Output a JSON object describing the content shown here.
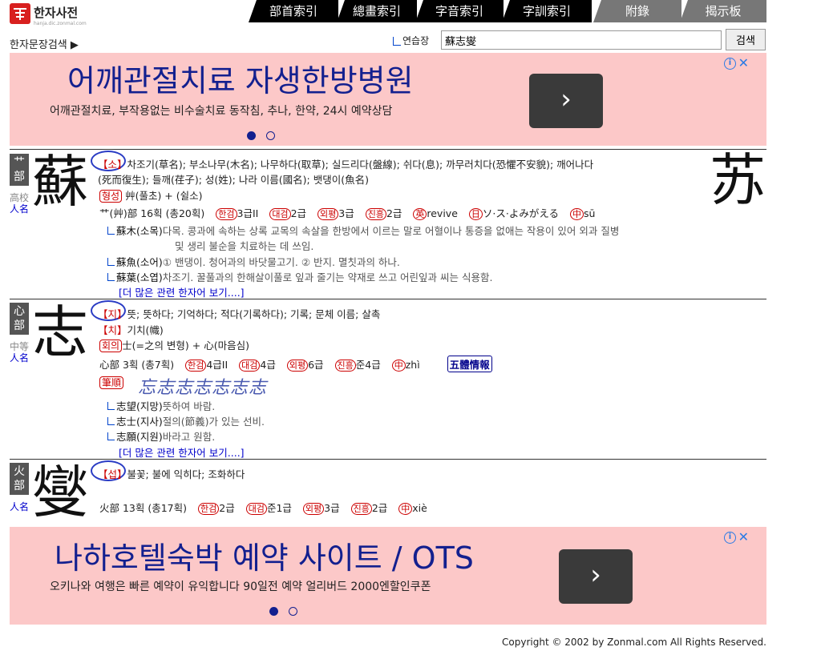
{
  "header": {
    "logo_title": "한자사전",
    "logo_sub": "hanja.dic.zonmal.com",
    "tabs": [
      "部首索引",
      "總畫索引",
      "字音索引",
      "字訓索引",
      "附錄",
      "揭示板"
    ],
    "search_label": "한자문장검색 ▶",
    "practice_label": "연습장",
    "search_value": "蘇志燮",
    "search_button": "검색"
  },
  "ads": [
    {
      "title": "어깨관절치료 자생한방병원",
      "desc": "어깨관절치료, 부작용없는 비수술치료 동작침, 추나, 한약, 24시 예약상담",
      "button": "›"
    },
    {
      "title": "나하호텔숙박 예약 사이트 / OTS",
      "desc": "오키나와 여행은 빠른 예약이 유익합니다 90일전 예약 얼리버드 2000엔할인쿠폰",
      "button": "›"
    }
  ],
  "entries": [
    {
      "radical": "艹部",
      "grade": "高校",
      "name_use": "人名",
      "char": "蘇",
      "simplified": "苏",
      "sound1": "【소】",
      "meaning1": "차조기(草名); 부소나무(木名); 나무하다(取草); 실드리다(盤線); 쉬다(息); 까무러치다(恐懼不安貌); 깨어나다",
      "meaning1b": "(死而復生); 들깨(荏子); 성(姓); 나라 이름(國名); 뱃댕이(魚名)",
      "formation_label": "형성",
      "formation": "艸(풀초) + (쉴소)",
      "stroke_info": "艹(艸)部 16획 (총20획)",
      "grades": [
        "한검",
        "3급II",
        "대검",
        "2급",
        "외평",
        "3급",
        "진흥",
        "2급"
      ],
      "readings": [
        "revive",
        "ソ·ス·よみがえる",
        "sū"
      ],
      "words": [
        {
          "word": "蘇木(소목)",
          "def": "다목. 콩과에 속하는 상록 교목의 속살을 한방에서 이르는 말로 어혈이나 통증을 없애는 작용이 있어 외과 질병"
        },
        {
          "word": "",
          "def": "및 생리 불순을 치료하는 데 쓰임."
        },
        {
          "word": "蘇魚(소어)",
          "def": "① 밴댕이. 청어과의 바닷물고기. ② 반지. 멸칫과의 하나."
        },
        {
          "word": "蘇葉(소엽)",
          "def": "차조기. 꿀풀과의 한해살이풀로 잎과 줄기는 약재로 쓰고 어린잎과 씨는 식용함."
        }
      ],
      "more": "[더 많은 관련 한자어 보기....]"
    },
    {
      "radical": "心部",
      "grade": "中等",
      "name_use": "人名",
      "char": "志",
      "sound1": "【지】",
      "meaning1": "뜻; 뜻하다; 기억하다; 적다(기록하다); 기록; 문체 이름; 살촉",
      "sound2": "【치】",
      "meaning2": "기치(幟)",
      "formation_label": "회의",
      "formation": "士(=之의 변형) + 心(마음심)",
      "stroke_info": "心部 3획 (총7획)",
      "grades": [
        "한검",
        "4급II",
        "대검",
        "4급",
        "외평",
        "6급",
        "진흥",
        "준4급"
      ],
      "readings": [
        "zhì"
      ],
      "five_body": "五體情報",
      "stroke_label": "筆順",
      "stroke_order": "忘志志志志志志",
      "words": [
        {
          "word": "志望(지망)",
          "def": "뜻하여 바람."
        },
        {
          "word": "志士(지사)",
          "def": "절의(節義)가 있는 선비."
        },
        {
          "word": "志願(지원)",
          "def": "바라고 원함."
        }
      ],
      "more": "[더 많은 관련 한자어 보기....]"
    },
    {
      "radical": "火部",
      "name_use": "人名",
      "char": "燮",
      "sound1": "【섭】",
      "meaning1": "불꽃; 불에 익히다; 조화하다",
      "stroke_info": "火部 13획 (총17획)",
      "grades": [
        "한검",
        "2급",
        "대검",
        "준1급",
        "외평",
        "3급",
        "진흥",
        "2급"
      ],
      "readings": [
        "xiè"
      ]
    }
  ],
  "footer": {
    "copyright": "Copyright © 2002 by Zonmal.com All Rights Reserved."
  },
  "colors": {
    "ad_bg": "#fcc8c8",
    "ad_title": "#13208f",
    "sound_red": "#cc0000",
    "link_blue": "#0000cc",
    "circle_blue": "#2a3cc4"
  }
}
